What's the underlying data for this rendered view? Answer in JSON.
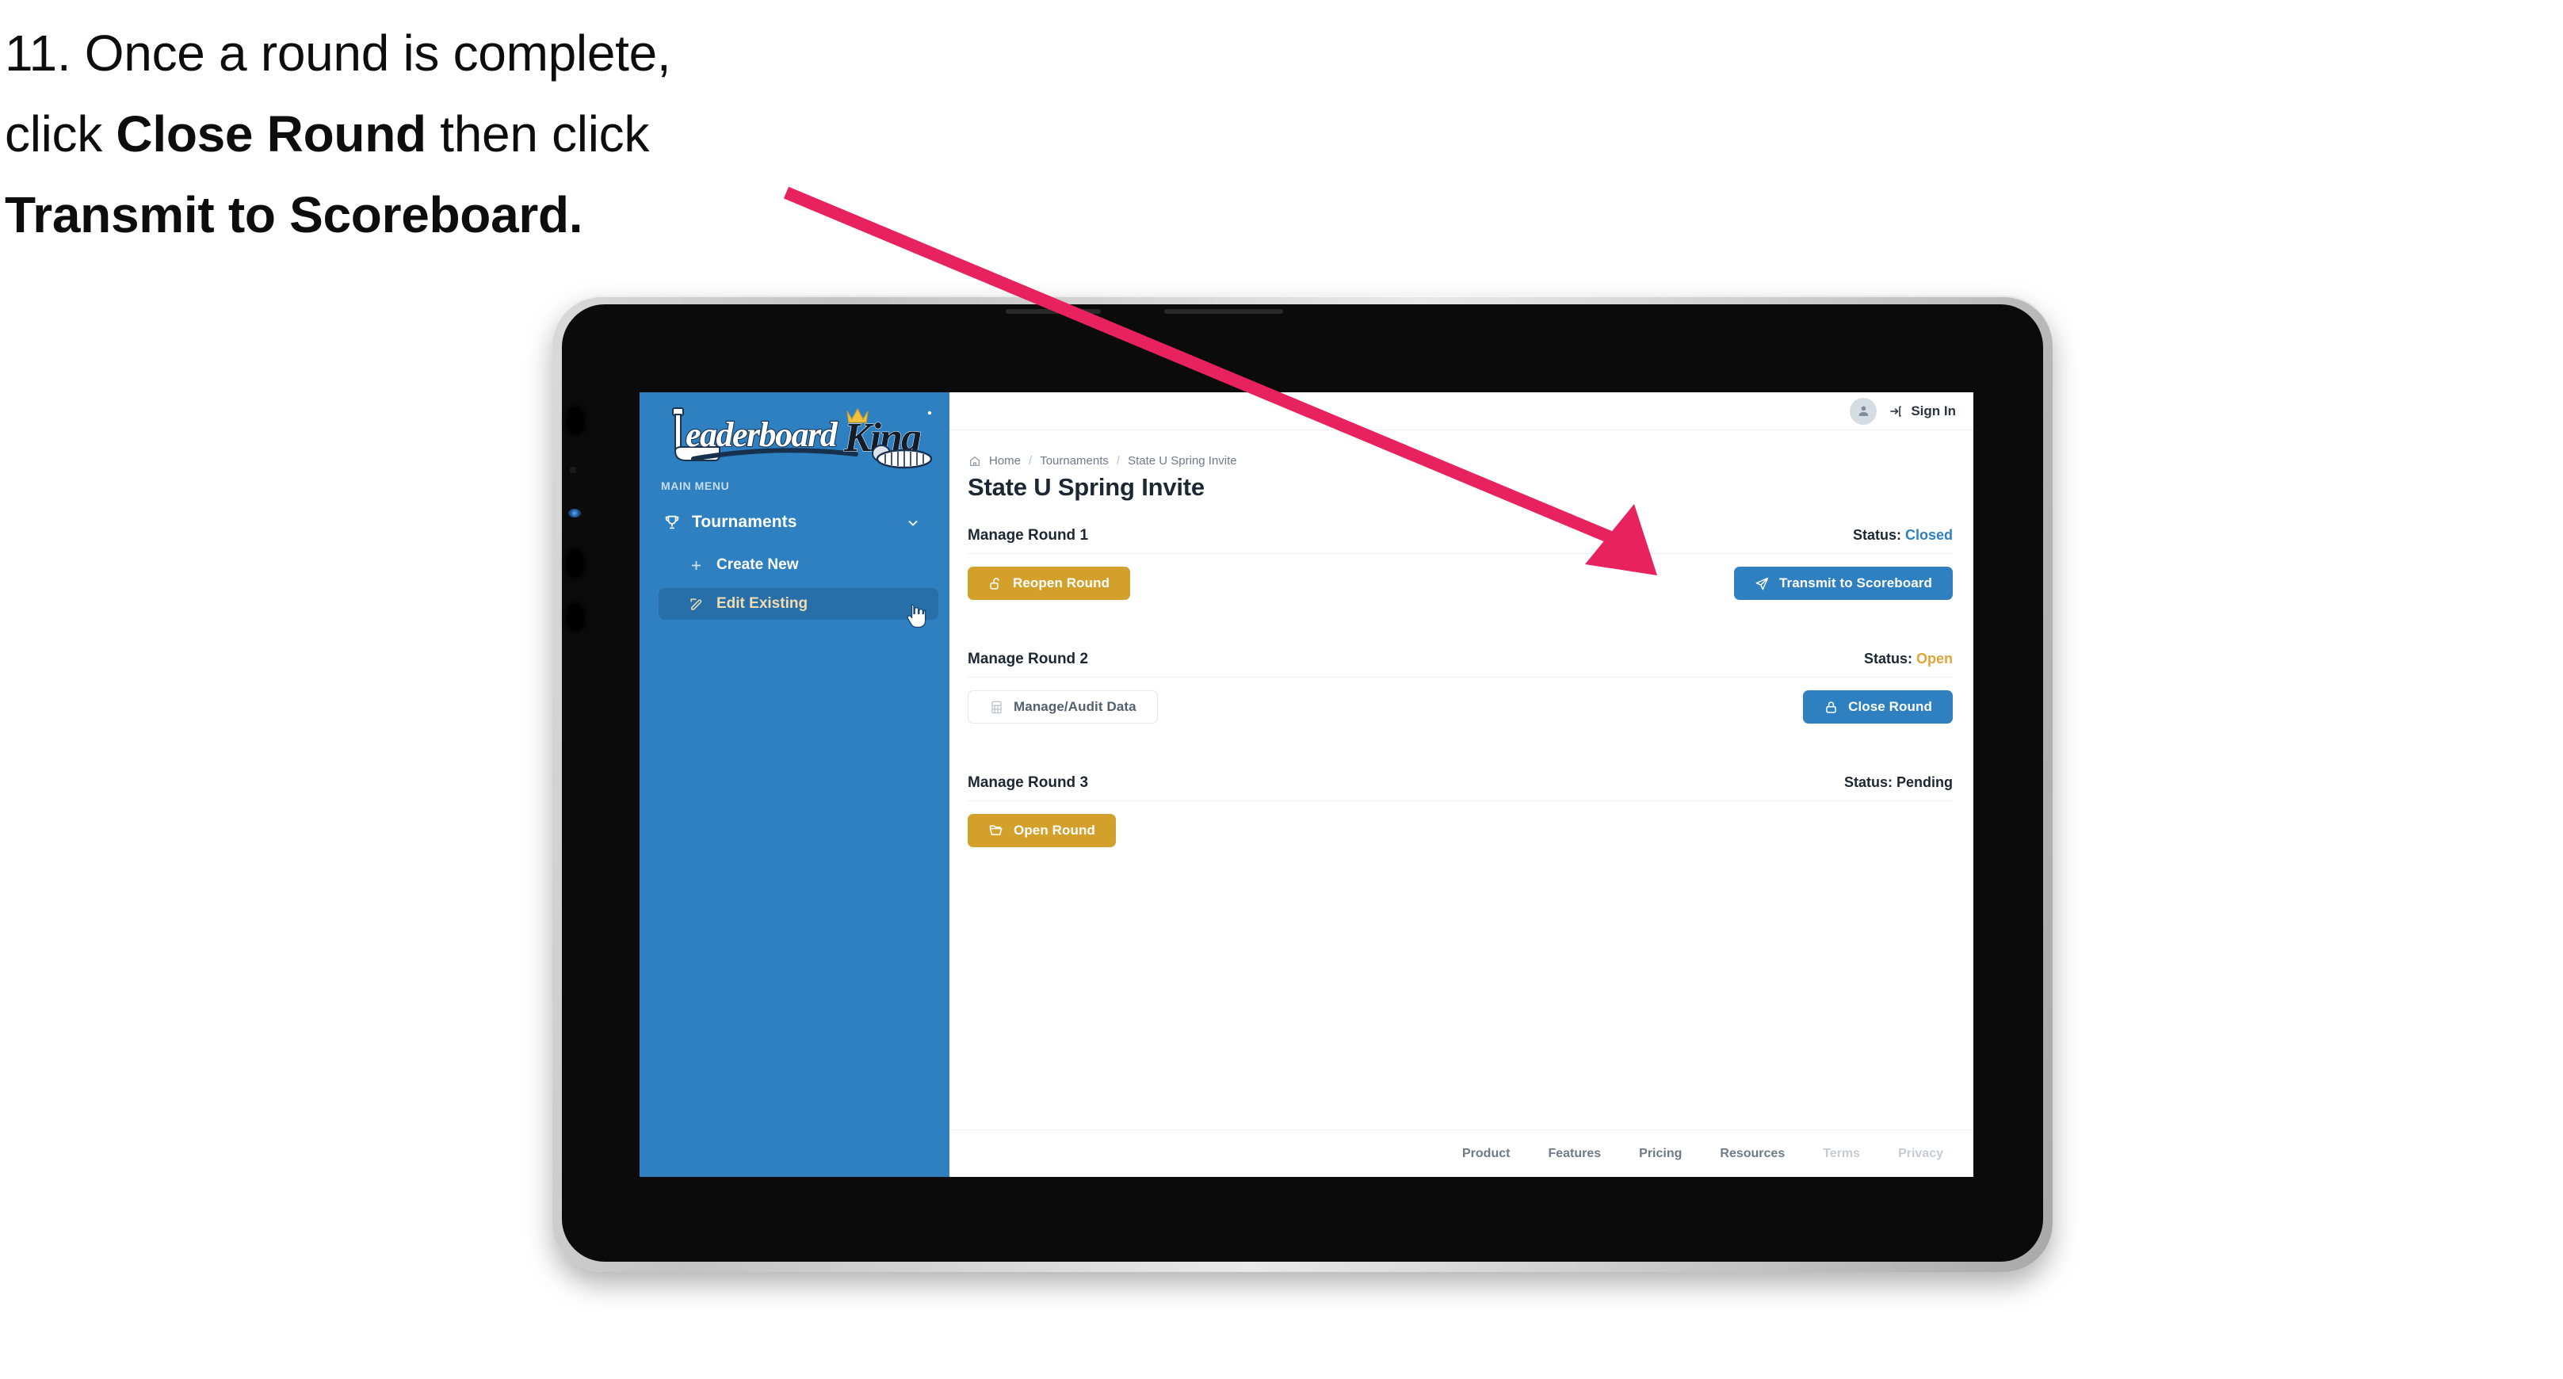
{
  "caption": {
    "line1_pre": "11. Once a round is complete,",
    "line2_pre": "click ",
    "line2_bold": "Close Round",
    "line2_post": " then click",
    "line3_bold": "Transmit to Scoreboard."
  },
  "annotation": {
    "arrow_color": "#E8225F",
    "arrow_name": "pointer-arrow-to-transmit-button"
  },
  "device": {
    "type": "tablet",
    "bezel_color": "#0b0b0b",
    "frame_color": "#d0d0d0"
  },
  "app": {
    "brand": {
      "word_primary": "Leaderboard",
      "word_secondary": "King",
      "accent_color": "#2e80c1",
      "crown_color": "#f2c13d",
      "king_color": "#121c2b"
    },
    "sidebar": {
      "background": "#2e80c1",
      "section_label": "MAIN MENU",
      "items": [
        {
          "label": "Tournaments",
          "icon": "trophy-icon",
          "chevron": "chevron-down-icon",
          "active": false
        },
        {
          "label": "Create New",
          "icon": "plus-icon",
          "active": false
        },
        {
          "label": "Edit Existing",
          "icon": "pencil-square-icon",
          "active": true
        }
      ]
    },
    "topbar": {
      "avatar_icon": "user-avatar-icon",
      "signin_icon": "sign-in-arrow-icon",
      "signin_label": "Sign In"
    },
    "breadcrumb": {
      "home_icon": "home-icon",
      "items": [
        "Home",
        "Tournaments",
        "State U Spring Invite"
      ],
      "separator": "/"
    },
    "page_title": "State U Spring Invite",
    "rounds": [
      {
        "title": "Manage Round 1",
        "status_label": "Status:",
        "status_value": "Closed",
        "status_color": "#2e80c1",
        "left_button": {
          "label": "Reopen Round",
          "icon": "unlock-icon",
          "style": "gold"
        },
        "right_button": {
          "label": "Transmit to Scoreboard",
          "icon": "paper-plane-icon",
          "style": "blue"
        }
      },
      {
        "title": "Manage Round 2",
        "status_label": "Status:",
        "status_value": "Open",
        "status_color": "#e0a43a",
        "left_button": {
          "label": "Manage/Audit Data",
          "icon": "table-grid-icon",
          "style": "ghost"
        },
        "right_button": {
          "label": "Close Round",
          "icon": "lock-icon",
          "style": "blue"
        }
      },
      {
        "title": "Manage Round 3",
        "status_label": "Status:",
        "status_value": "Pending",
        "status_color": "#1d2734",
        "left_button": {
          "label": "Open Round",
          "icon": "folder-open-icon",
          "style": "gold"
        },
        "right_button": null
      }
    ],
    "footer": {
      "links": [
        {
          "label": "Product",
          "muted": false
        },
        {
          "label": "Features",
          "muted": false
        },
        {
          "label": "Pricing",
          "muted": false
        },
        {
          "label": "Resources",
          "muted": false
        },
        {
          "label": "Terms",
          "muted": true
        },
        {
          "label": "Privacy",
          "muted": true
        }
      ]
    },
    "cursor": {
      "icon": "pointer-hand-cursor"
    }
  }
}
